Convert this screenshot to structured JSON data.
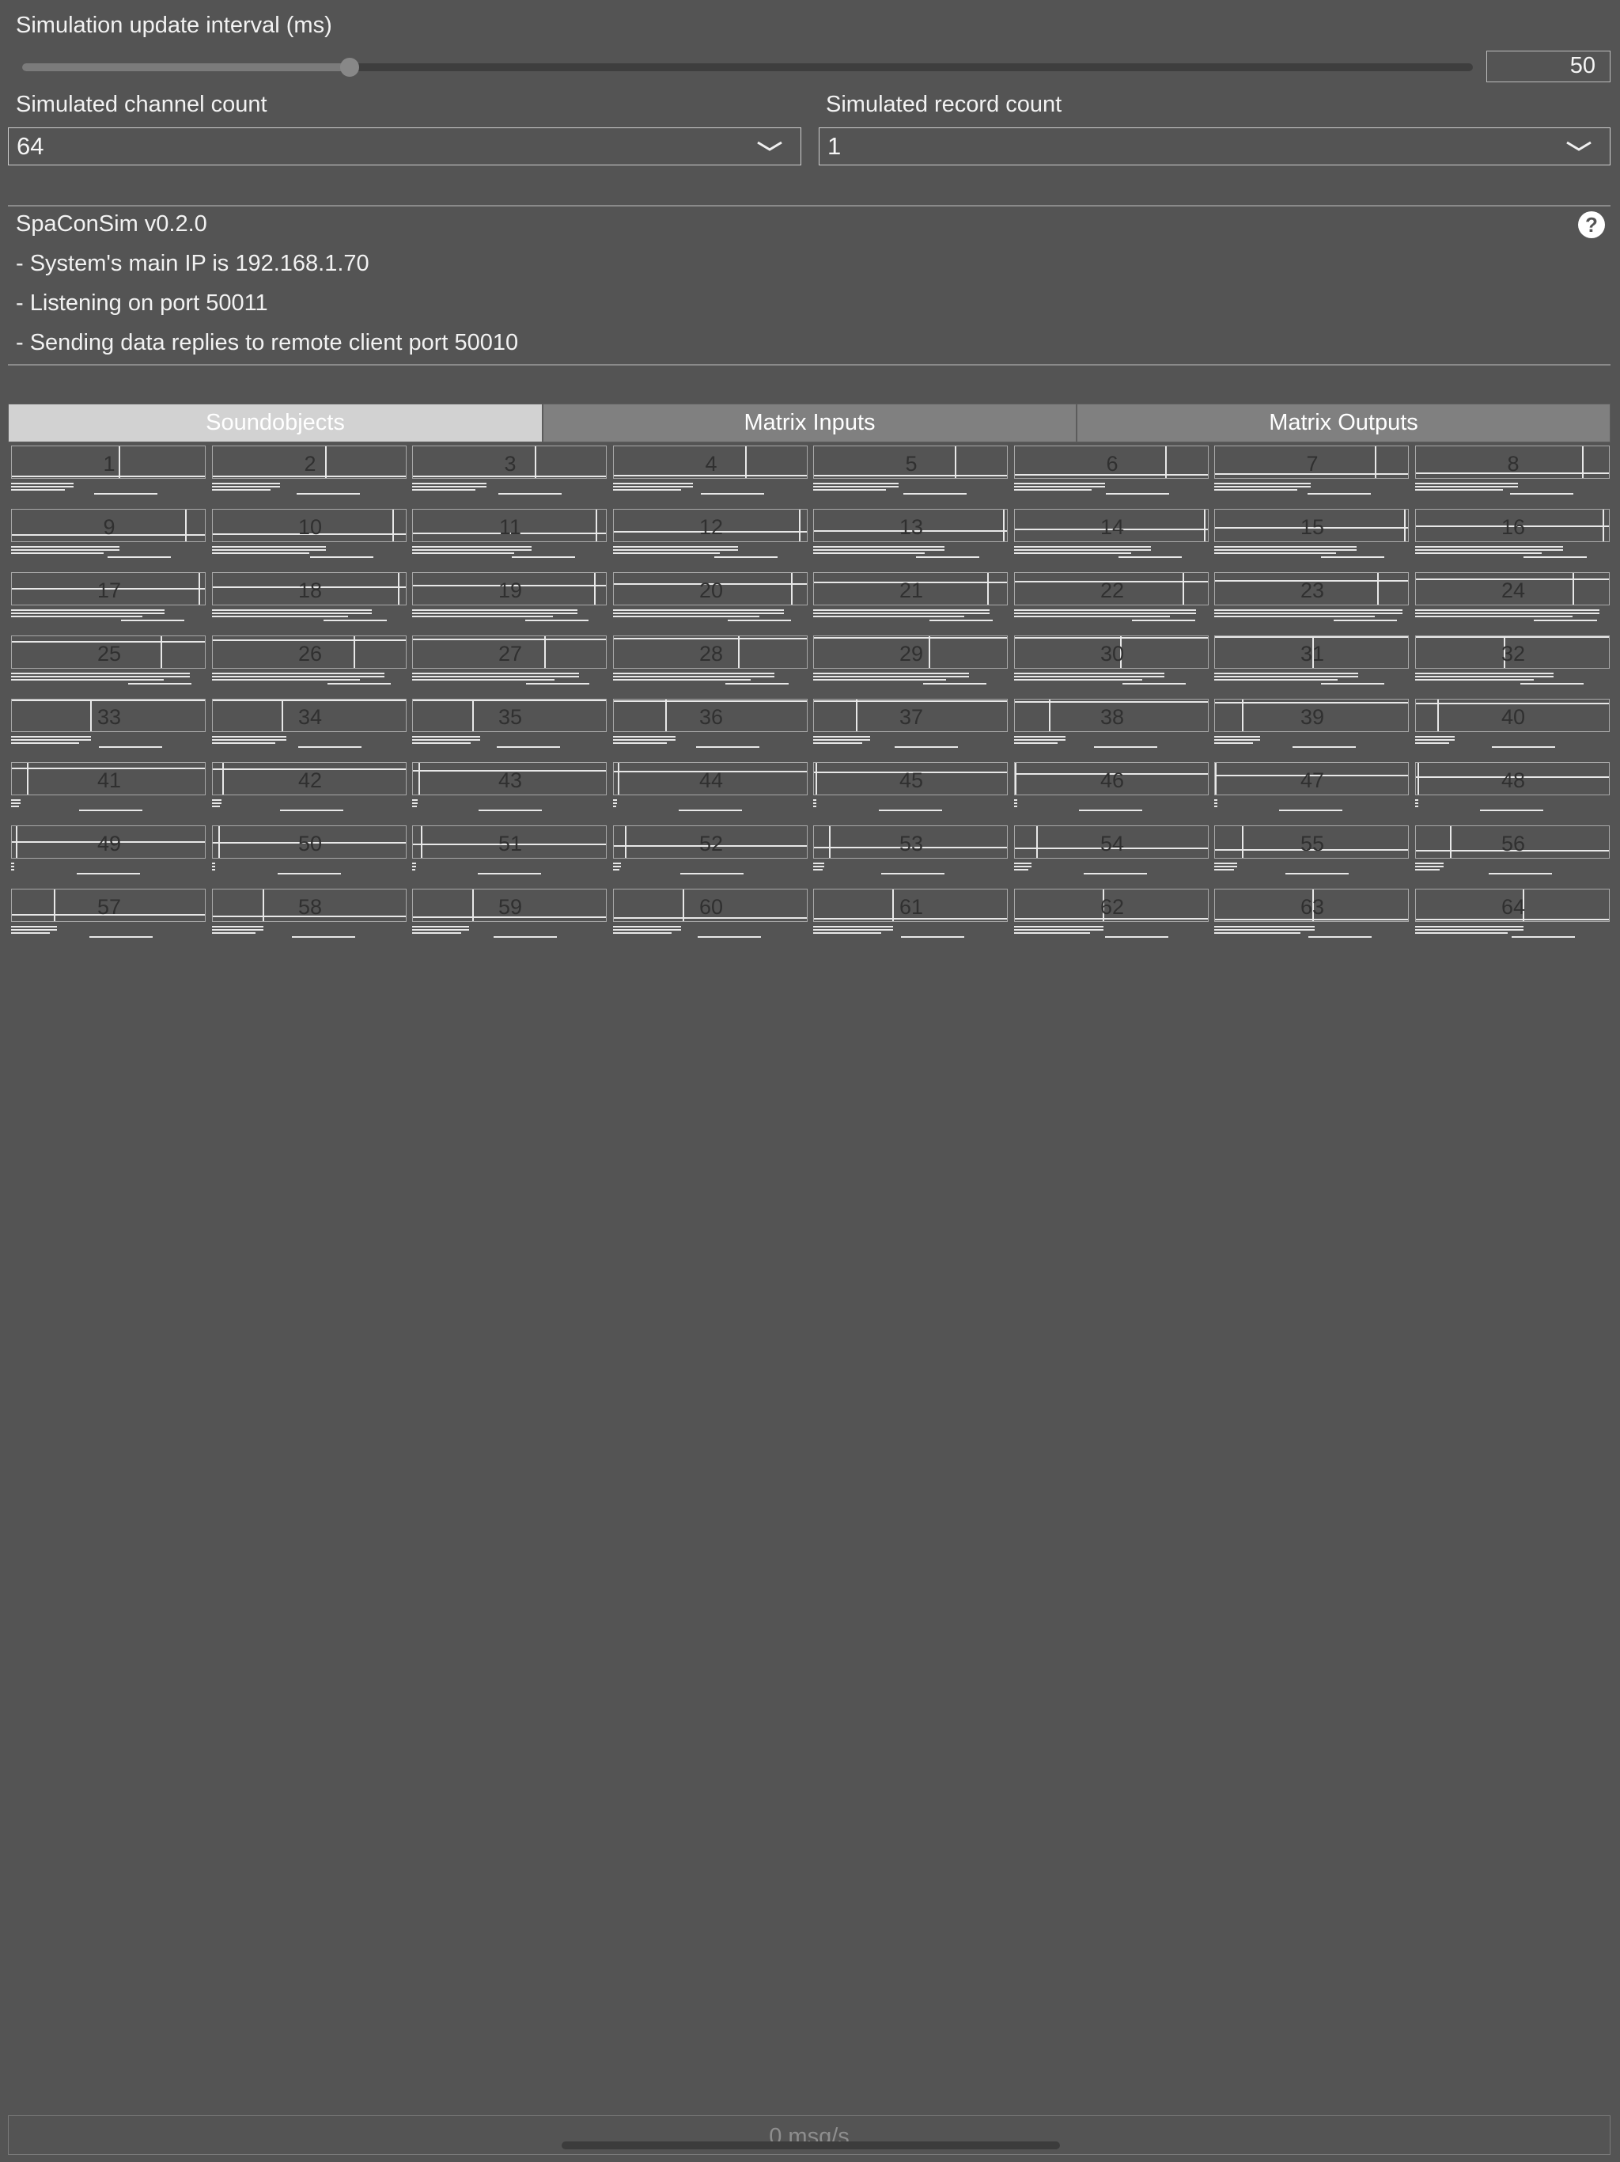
{
  "settings": {
    "interval_label": "Simulation update interval (ms)",
    "interval_value": "50",
    "interval_slider_fraction": 0.226,
    "channel_label": "Simulated channel count",
    "channel_value": "64",
    "record_label": "Simulated record count",
    "record_value": "1"
  },
  "info": {
    "title": "SpaConSim v0.2.0",
    "lines": [
      "- System's main IP is 192.168.1.70",
      "- Listening on port 50011",
      "- Sending data replies to remote client port 50010"
    ],
    "help_glyph": "?"
  },
  "tabs": [
    {
      "label": "Soundobjects",
      "active": true
    },
    {
      "label": "Matrix Inputs",
      "active": false
    },
    {
      "label": "Matrix Outputs",
      "active": false
    }
  ],
  "soundobjects": {
    "numbers": [
      "1",
      "2",
      "3",
      "4",
      "5",
      "6",
      "7",
      "8",
      "9",
      "10",
      "11",
      "12",
      "13",
      "14",
      "15",
      "16",
      "17",
      "18",
      "19",
      "20",
      "21",
      "22",
      "23",
      "24",
      "25",
      "26",
      "27",
      "28",
      "29",
      "30",
      "31",
      "32",
      "33",
      "34",
      "35",
      "36",
      "37",
      "38",
      "39",
      "40",
      "41",
      "42",
      "43",
      "44",
      "45",
      "46",
      "47",
      "48",
      "49",
      "50",
      "51",
      "52",
      "53",
      "54",
      "55",
      "56",
      "57",
      "58",
      "59",
      "60",
      "61",
      "62",
      "63",
      "64"
    ],
    "x": [
      0.56,
      0.59,
      0.64,
      0.69,
      0.74,
      0.79,
      0.84,
      0.87,
      0.91,
      0.94,
      0.96,
      0.97,
      0.99,
      0.99,
      0.99,
      0.98,
      0.98,
      0.97,
      0.95,
      0.93,
      0.91,
      0.88,
      0.85,
      0.82,
      0.78,
      0.74,
      0.69,
      0.65,
      0.6,
      0.55,
      0.51,
      0.46,
      0.41,
      0.36,
      0.31,
      0.27,
      0.22,
      0.18,
      0.14,
      0.11,
      0.08,
      0.05,
      0.03,
      0.02,
      0.01,
      0.0,
      0.0,
      0.01,
      0.02,
      0.03,
      0.04,
      0.06,
      0.08,
      0.11,
      0.14,
      0.18,
      0.22,
      0.26,
      0.31,
      0.36,
      0.41,
      0.46,
      0.51,
      0.56
    ],
    "y": [
      1.0,
      1.0,
      0.99,
      0.98,
      0.96,
      0.94,
      0.92,
      0.89,
      0.85,
      0.82,
      0.78,
      0.74,
      0.69,
      0.64,
      0.6,
      0.55,
      0.5,
      0.45,
      0.4,
      0.36,
      0.31,
      0.27,
      0.23,
      0.19,
      0.15,
      0.12,
      0.09,
      0.06,
      0.04,
      0.02,
      0.01,
      0.0,
      0.0,
      0.0,
      0.01,
      0.02,
      0.04,
      0.06,
      0.09,
      0.12,
      0.15,
      0.19,
      0.23,
      0.27,
      0.31,
      0.36,
      0.4,
      0.45,
      0.5,
      0.55,
      0.6,
      0.64,
      0.69,
      0.74,
      0.78,
      0.82,
      0.85,
      0.89,
      0.92,
      0.94,
      0.96,
      0.98,
      0.99,
      1.0
    ],
    "send_level": [
      0.33,
      0.36,
      0.39,
      0.42,
      0.45,
      0.48,
      0.51,
      0.54,
      0.57,
      0.6,
      0.63,
      0.66,
      0.69,
      0.72,
      0.75,
      0.78,
      0.81,
      0.84,
      0.87,
      0.9,
      0.93,
      0.96,
      0.99,
      0.97,
      0.94,
      0.91,
      0.88,
      0.85,
      0.82,
      0.79,
      0.76,
      0.73,
      0.42,
      0.39,
      0.36,
      0.33,
      0.3,
      0.27,
      0.24,
      0.21,
      0.05,
      0.05,
      0.03,
      0.02,
      0.01,
      0.0,
      0.0,
      0.0,
      0.01,
      0.01,
      0.02,
      0.04,
      0.06,
      0.09,
      0.12,
      0.15,
      0.24,
      0.27,
      0.3,
      0.36,
      0.42,
      0.47,
      0.53,
      0.57
    ]
  },
  "status": {
    "rate": "0 msg/s"
  }
}
